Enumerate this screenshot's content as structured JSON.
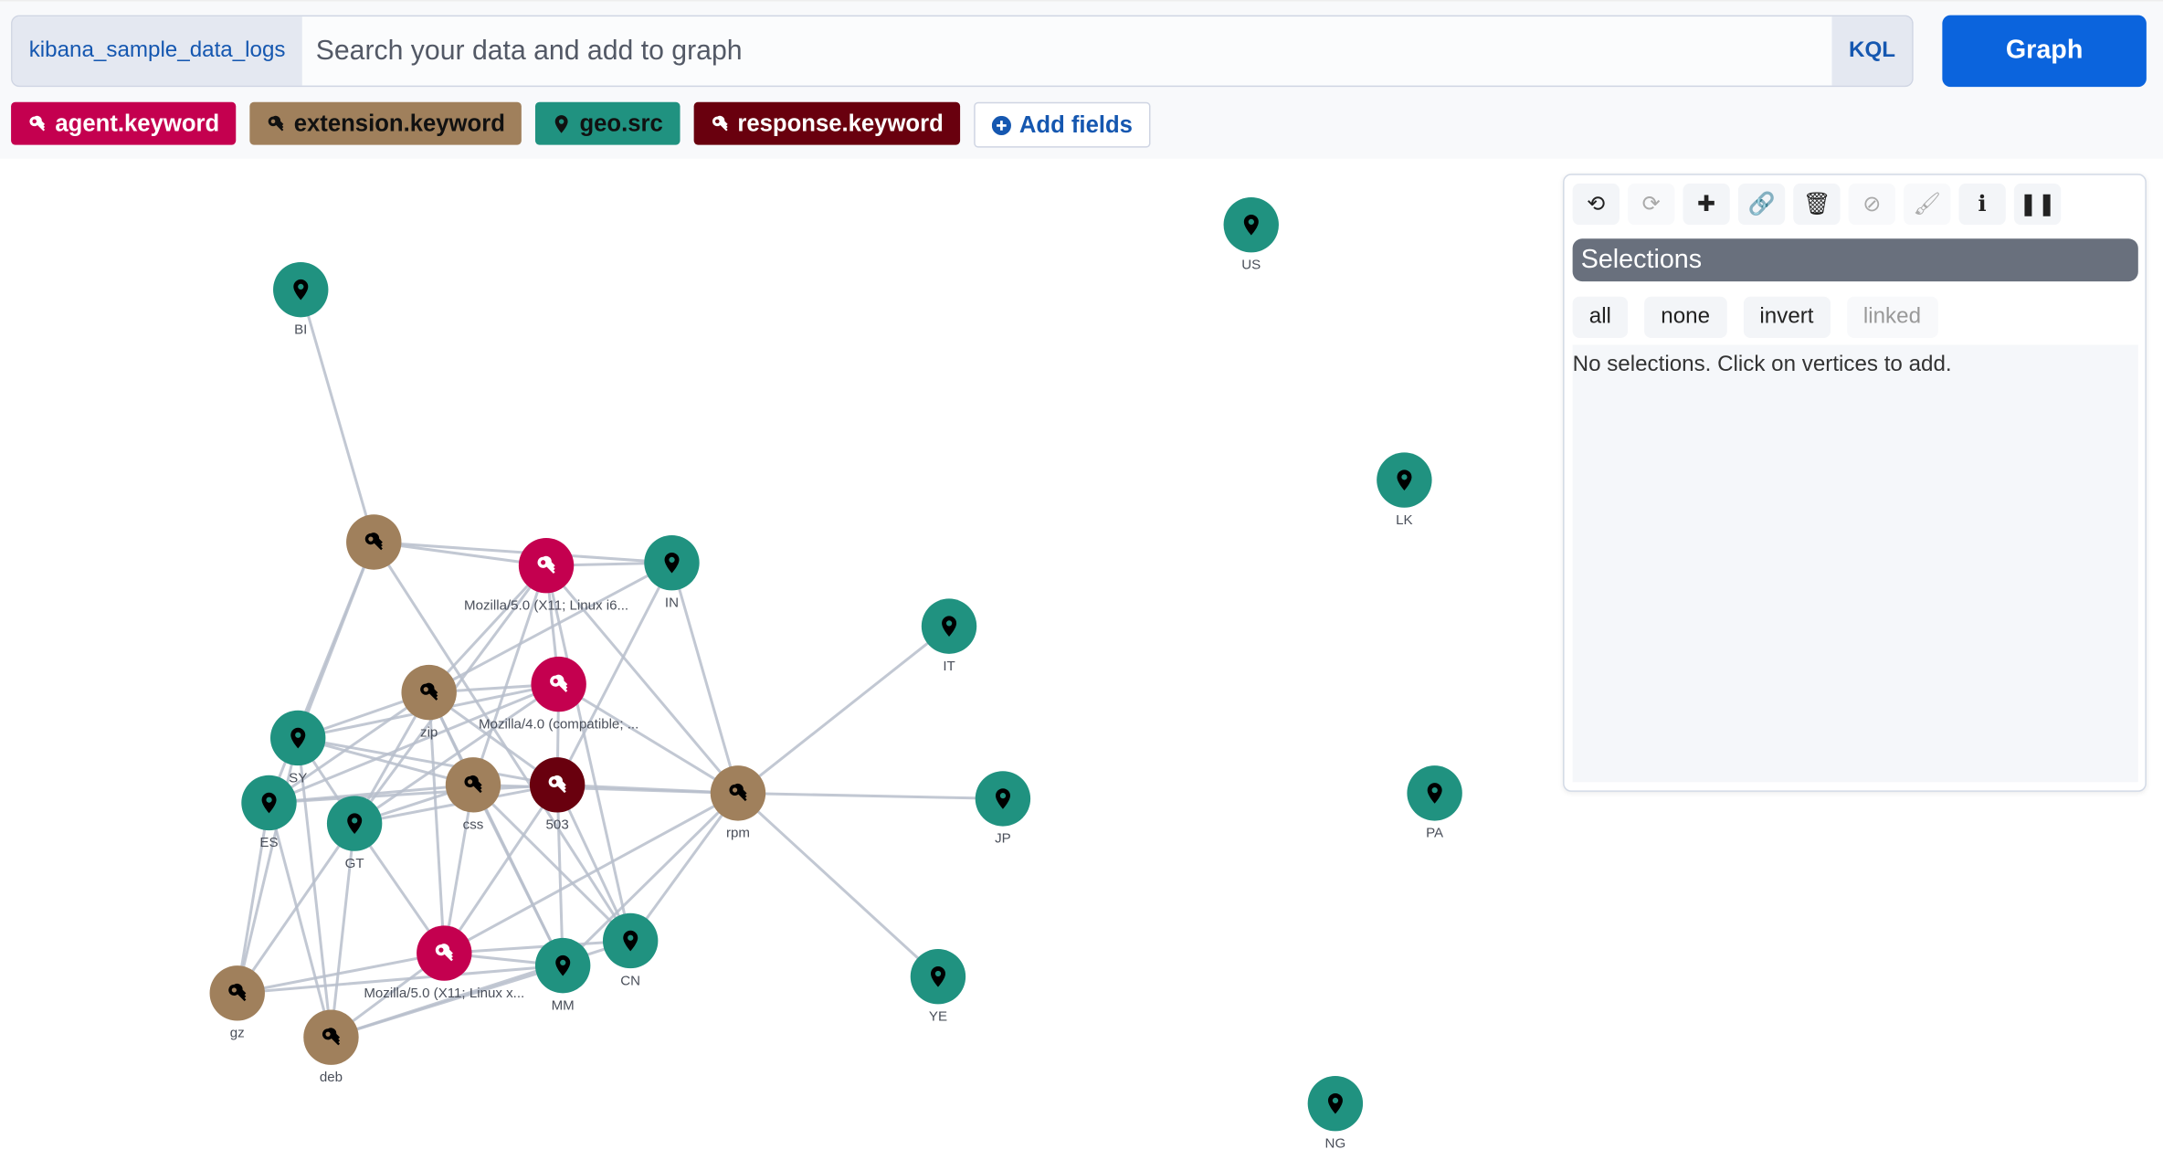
{
  "search": {
    "index": "kibana_sample_data_logs",
    "placeholder": "Search your data and add to graph",
    "value": "",
    "language": "KQL",
    "submit": "Graph"
  },
  "fields": [
    {
      "label": "agent.keyword",
      "icon": "key-icon",
      "color": "#c4004f",
      "text": "#ffffff"
    },
    {
      "label": "extension.keyword",
      "icon": "key-icon",
      "color": "#a0805c",
      "text": "#111111"
    },
    {
      "label": "geo.src",
      "icon": "map-pin-icon",
      "color": "#209280",
      "text": "#111111"
    },
    {
      "label": "response.keyword",
      "icon": "key-icon",
      "color": "#69000e",
      "text": "#ffffff"
    }
  ],
  "add_fields": "Add fields",
  "toolbar": [
    {
      "name": "undo",
      "glyph": "⟲",
      "disabled": false
    },
    {
      "name": "redo",
      "glyph": "⟳",
      "disabled": true
    },
    {
      "name": "expand",
      "glyph": "✚",
      "disabled": false
    },
    {
      "name": "link",
      "glyph": "🔗",
      "disabled": false
    },
    {
      "name": "delete",
      "glyph": "🗑",
      "disabled": false
    },
    {
      "name": "blocklist",
      "glyph": "⊘",
      "disabled": true
    },
    {
      "name": "style",
      "glyph": "🖌",
      "disabled": true
    },
    {
      "name": "info",
      "glyph": "ℹ",
      "disabled": false
    },
    {
      "name": "pause",
      "glyph": "❚❚",
      "disabled": false
    }
  ],
  "selections": {
    "title": "Selections",
    "buttons": [
      {
        "label": "all",
        "disabled": false
      },
      {
        "label": "none",
        "disabled": false
      },
      {
        "label": "invert",
        "disabled": false
      },
      {
        "label": "linked",
        "disabled": true
      }
    ],
    "empty": "No selections. Click on vertices to add."
  },
  "colors": {
    "geo": "#209280",
    "ext": "#a0805c",
    "agent": "#c4004f",
    "response": "#69000e",
    "edge": "#b8bfcc"
  },
  "nodes": [
    {
      "id": "BI",
      "type": "geo",
      "label": "BI"
    },
    {
      "id": "US",
      "type": "geo",
      "label": "US"
    },
    {
      "id": "LK",
      "type": "geo",
      "label": "LK"
    },
    {
      "id": "IT",
      "type": "geo",
      "label": "IT"
    },
    {
      "id": "JP",
      "type": "geo",
      "label": "JP"
    },
    {
      "id": "PA",
      "type": "geo",
      "label": "PA"
    },
    {
      "id": "YE",
      "type": "geo",
      "label": "YE"
    },
    {
      "id": "NG",
      "type": "geo",
      "label": "NG"
    },
    {
      "id": "IN",
      "type": "geo",
      "label": "IN"
    },
    {
      "id": "SY",
      "type": "geo",
      "label": "SY"
    },
    {
      "id": "ES",
      "type": "geo",
      "label": "ES"
    },
    {
      "id": "GT",
      "type": "geo",
      "label": "GT"
    },
    {
      "id": "MM",
      "type": "geo",
      "label": "MM"
    },
    {
      "id": "CN",
      "type": "geo",
      "label": "CN"
    },
    {
      "id": "ext0",
      "type": "ext",
      "label": ""
    },
    {
      "id": "zip",
      "type": "ext",
      "label": "zip"
    },
    {
      "id": "css",
      "type": "ext",
      "label": "css"
    },
    {
      "id": "rpm",
      "type": "ext",
      "label": "rpm"
    },
    {
      "id": "gz",
      "type": "ext",
      "label": "gz"
    },
    {
      "id": "deb",
      "type": "ext",
      "label": "deb"
    },
    {
      "id": "a1",
      "type": "agent",
      "label": "Mozilla/5.0 (X11; Linux i6..."
    },
    {
      "id": "a2",
      "type": "agent",
      "label": "Mozilla/4.0 (compatible; ..."
    },
    {
      "id": "a3",
      "type": "agent",
      "label": "Mozilla/5.0 (X11; Linux x..."
    },
    {
      "id": "r503",
      "type": "response",
      "label": "503"
    }
  ],
  "edges": [
    [
      "BI",
      "ext0"
    ],
    [
      "ext0",
      "a1"
    ],
    [
      "ext0",
      "IN"
    ],
    [
      "a1",
      "IN"
    ],
    [
      "ext0",
      "SY"
    ],
    [
      "ext0",
      "CN"
    ],
    [
      "ext0",
      "ES"
    ],
    [
      "a1",
      "zip"
    ],
    [
      "a1",
      "a2"
    ],
    [
      "a1",
      "rpm"
    ],
    [
      "a1",
      "GT"
    ],
    [
      "a1",
      "css"
    ],
    [
      "IN",
      "zip"
    ],
    [
      "IN",
      "rpm"
    ],
    [
      "IN",
      "r503"
    ],
    [
      "zip",
      "a2"
    ],
    [
      "zip",
      "SY"
    ],
    [
      "zip",
      "ES"
    ],
    [
      "zip",
      "GT"
    ],
    [
      "zip",
      "css"
    ],
    [
      "zip",
      "r503"
    ],
    [
      "zip",
      "a3"
    ],
    [
      "zip",
      "MM"
    ],
    [
      "a2",
      "SY"
    ],
    [
      "a2",
      "ES"
    ],
    [
      "a2",
      "r503"
    ],
    [
      "a2",
      "rpm"
    ],
    [
      "a2",
      "GT"
    ],
    [
      "SY",
      "css"
    ],
    [
      "SY",
      "r503"
    ],
    [
      "SY",
      "gz"
    ],
    [
      "SY",
      "deb"
    ],
    [
      "SY",
      "GT"
    ],
    [
      "ES",
      "css"
    ],
    [
      "ES",
      "r503"
    ],
    [
      "ES",
      "gz"
    ],
    [
      "ES",
      "deb"
    ],
    [
      "GT",
      "css"
    ],
    [
      "GT",
      "a3"
    ],
    [
      "GT",
      "gz"
    ],
    [
      "GT",
      "deb"
    ],
    [
      "GT",
      "r503"
    ],
    [
      "css",
      "rpm"
    ],
    [
      "css",
      "a3"
    ],
    [
      "css",
      "CN"
    ],
    [
      "css",
      "MM"
    ],
    [
      "r503",
      "rpm"
    ],
    [
      "r503",
      "MM"
    ],
    [
      "r503",
      "CN"
    ],
    [
      "r503",
      "a3"
    ],
    [
      "rpm",
      "IT"
    ],
    [
      "rpm",
      "JP"
    ],
    [
      "rpm",
      "YE"
    ],
    [
      "rpm",
      "CN"
    ],
    [
      "rpm",
      "MM"
    ],
    [
      "rpm",
      "a3"
    ],
    [
      "a3",
      "gz"
    ],
    [
      "a3",
      "deb"
    ],
    [
      "a3",
      "MM"
    ],
    [
      "a3",
      "CN"
    ],
    [
      "MM",
      "gz"
    ],
    [
      "MM",
      "deb"
    ],
    [
      "CN",
      "deb"
    ],
    [
      "CN",
      "a1"
    ]
  ]
}
